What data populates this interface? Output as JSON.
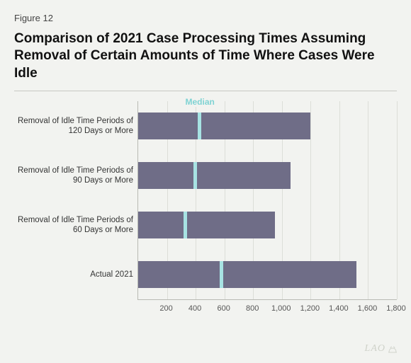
{
  "figure_number": "Figure 12",
  "title": "Comparison of 2021 Case Processing Times Assuming Removal of Certain Amounts of Time Where Cases Were Idle",
  "legend_label": "Median",
  "logo_text": "LAO",
  "chart_data": {
    "type": "bar",
    "orientation": "horizontal",
    "xlabel": "",
    "ylabel": "",
    "xlim": [
      0,
      1800
    ],
    "xticks": [
      200,
      400,
      600,
      800,
      1000,
      1200,
      1400,
      1600,
      1800
    ],
    "xtick_labels": [
      "200",
      "400",
      "600",
      "800",
      "1,000",
      "1,200",
      "1,400",
      "1,600",
      "1,800"
    ],
    "categories": [
      "Removal of Idle Time Periods of 120 Days or More",
      "Removal of Idle Time Periods of 90 Days or More",
      "Removal of Idle Time Periods of 60 Days or More",
      "Actual 2021"
    ],
    "values": [
      1200,
      1060,
      950,
      1520
    ],
    "median_values": [
      430,
      400,
      330,
      580
    ],
    "bar_color": "#6f6d87",
    "median_color": "#a7e3e3"
  }
}
